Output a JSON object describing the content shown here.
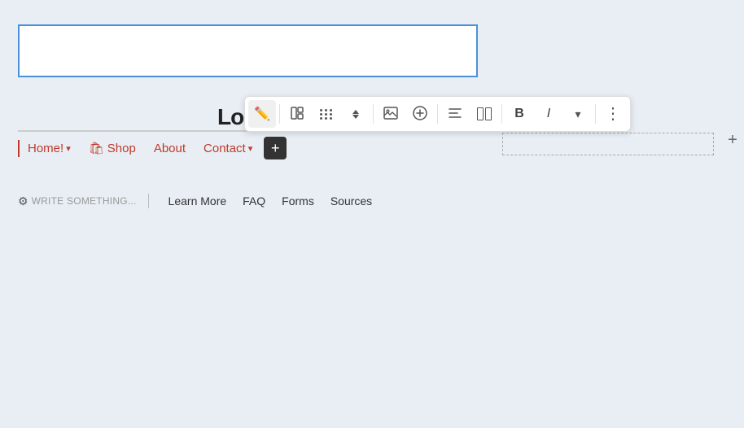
{
  "logo": {
    "text": "Lo"
  },
  "toolbar": {
    "buttons": [
      {
        "id": "pencil",
        "icon": "pencil",
        "label": "Edit",
        "active": true
      },
      {
        "id": "layout",
        "icon": "layout",
        "label": "Layout"
      },
      {
        "id": "dots-grid",
        "icon": "dots-grid",
        "label": "Grid"
      },
      {
        "id": "updown",
        "icon": "updown",
        "label": "Move"
      },
      {
        "id": "image",
        "icon": "image",
        "label": "Image"
      },
      {
        "id": "plus-circle",
        "icon": "plus-circle",
        "label": "Add"
      },
      {
        "id": "align-text",
        "icon": "align-text",
        "label": "Align Text"
      },
      {
        "id": "col-layout",
        "icon": "col-layout",
        "label": "Column Layout"
      },
      {
        "id": "lines",
        "icon": "lines",
        "label": "Lines"
      },
      {
        "id": "bold",
        "icon": "bold",
        "label": "Bold"
      },
      {
        "id": "italic",
        "icon": "italic",
        "label": "Italic"
      },
      {
        "id": "dropdown",
        "icon": "dropdown",
        "label": "More Options"
      },
      {
        "id": "more",
        "icon": "more",
        "label": "More"
      }
    ]
  },
  "nav": {
    "items": [
      {
        "id": "home",
        "label": "Home!",
        "has_dropdown": true,
        "active": true
      },
      {
        "id": "shop",
        "label": "Shop",
        "has_icon": true,
        "icon": "🛍"
      },
      {
        "id": "about",
        "label": "About",
        "has_dropdown": false
      },
      {
        "id": "contact",
        "label": "Contact",
        "has_dropdown": true
      }
    ],
    "add_button_label": "+"
  },
  "secondary_nav": {
    "write_placeholder": "WRITE SOMETHING...",
    "links": [
      {
        "id": "learn-more",
        "label": "Learn More"
      },
      {
        "id": "faq",
        "label": "FAQ"
      },
      {
        "id": "forms",
        "label": "Forms"
      },
      {
        "id": "sources",
        "label": "Sources"
      }
    ]
  },
  "colors": {
    "accent": "#c0392b",
    "toolbar_bg": "#ffffff",
    "page_bg": "#e8eef4",
    "nav_text": "#c0392b",
    "border_blue": "#4a90d9"
  }
}
